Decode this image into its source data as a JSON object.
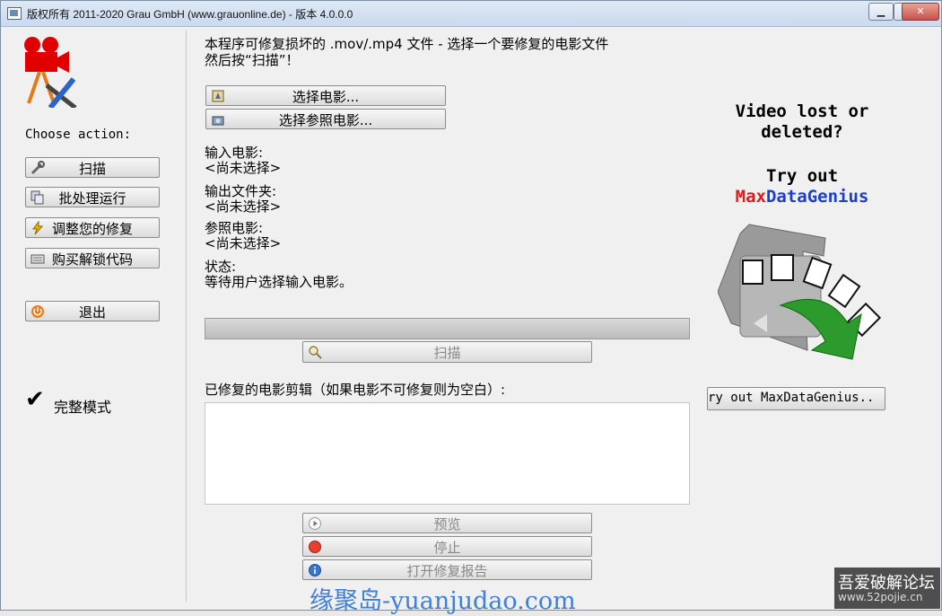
{
  "window": {
    "title": "版权所有 2011-2020 Grau GmbH (www.grauonline.de) - 版本 4.0.0.0",
    "min_glyph": "▁",
    "max_glyph": "□",
    "close_glyph": "✕"
  },
  "sidebar": {
    "choose_action": "Choose action:",
    "scan": "扫描",
    "batch": "批处理运行",
    "tune": "调整您的修复",
    "buy": "购买解锁代码",
    "exit": "退出",
    "full_mode_check": "✔",
    "full_mode": "完整模式"
  },
  "main": {
    "heading": "本程序可修复损坏的 .mov/.mp4 文件 - 选择一个要修复的电影文件\n然后按“扫描”！",
    "select_movie": "选择电影...",
    "select_reference": "选择参照电影...",
    "input_movie_label": "输入电影:",
    "input_movie_value": "<尚未选择>",
    "output_folder_label": "输出文件夹:",
    "output_folder_value": "<尚未选择>",
    "reference_label": "参照电影:",
    "reference_value": "<尚未选择>",
    "status_label": "状态:",
    "status_value": "等待用户选择输入电影。",
    "scan": "扫描",
    "clips_label": "已修复的电影剪辑（如果电影不可修复则为空白）:",
    "preview": "预览",
    "stop": "停止",
    "open_report": "打开修复报告"
  },
  "promo": {
    "line1": "Video lost or",
    "line2": "deleted?",
    "try_out": "Try out",
    "brand_a": "Max",
    "brand_b": "Data",
    "brand_c": "Genius",
    "button": "ry out MaxDataGenius.."
  },
  "overlay": {
    "watermark": "缘聚岛-yuanjudao.com",
    "site_name": "吾爱破解论坛",
    "site_url": "www.52pojie.cn"
  }
}
